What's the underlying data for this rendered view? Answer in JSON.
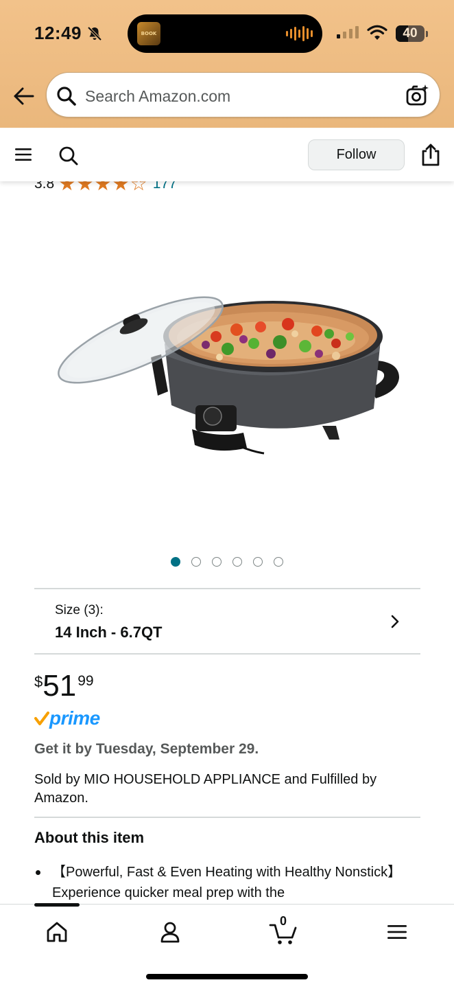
{
  "status": {
    "time": "12:49",
    "battery": "40",
    "island_art_text": "BOOK"
  },
  "search": {
    "placeholder": "Search Amazon.com"
  },
  "subnav": {
    "follow_label": "Follow"
  },
  "rating": {
    "value": "3.8",
    "stars": 3.8,
    "count": "177"
  },
  "gallery": {
    "total_images": 6,
    "active_index": 0
  },
  "size": {
    "label": "Size (3):",
    "value": "14 Inch - 6.7QT"
  },
  "price": {
    "symbol": "$",
    "whole": "51",
    "fraction": "99"
  },
  "prime": {
    "label": "prime"
  },
  "delivery": {
    "text": "Get it by Tuesday, September 29."
  },
  "seller": {
    "text": "Sold by MIO HOUSEHOLD APPLIANCE and Fulfilled by Amazon."
  },
  "about": {
    "title": "About this item",
    "bullet_1": "【Powerful, Fast & Even Heating with Healthy Nonstick】Experience quicker meal prep with the"
  },
  "tabbar": {
    "cart_count": "0",
    "tabs": [
      "home-icon",
      "account-icon",
      "cart-icon",
      "menu-icon"
    ]
  },
  "colors": {
    "header_bg": "#eab77c",
    "link": "#007185",
    "star": "#de7921",
    "prime_blue": "#1a98ff",
    "prime_check": "#f7a000"
  }
}
